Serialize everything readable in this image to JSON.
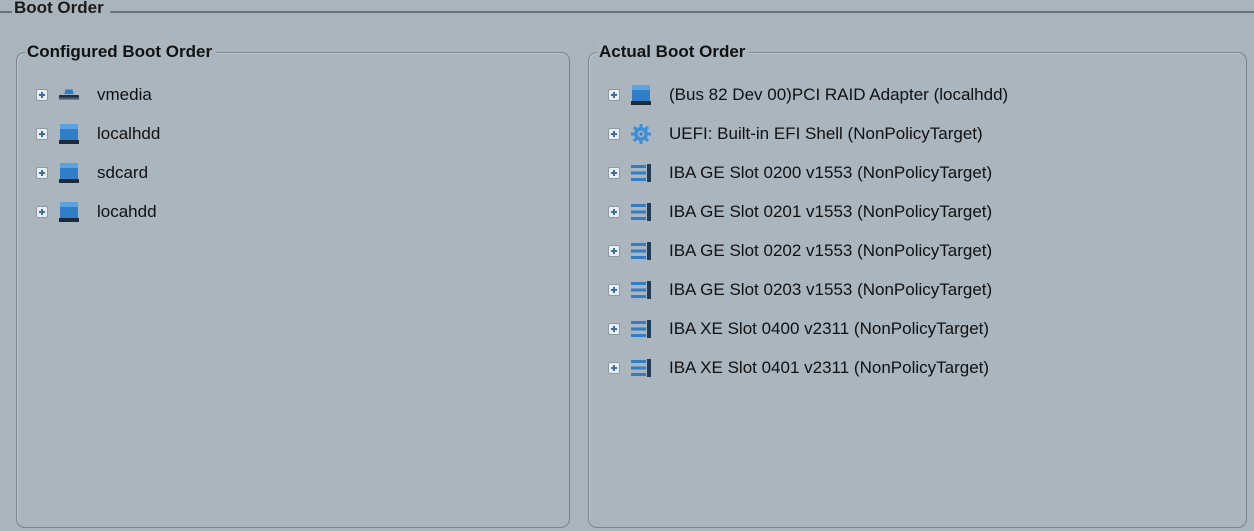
{
  "boot_order": {
    "title": "Boot Order",
    "configured": {
      "title": "Configured Boot Order",
      "items": [
        {
          "label": "vmedia",
          "icon": "vmedia-icon"
        },
        {
          "label": "localhdd",
          "icon": "hdd-icon"
        },
        {
          "label": "sdcard",
          "icon": "hdd-icon"
        },
        {
          "label": "locahdd",
          "icon": "hdd-icon"
        }
      ]
    },
    "actual": {
      "title": "Actual Boot Order",
      "items": [
        {
          "label": "(Bus 82 Dev 00)PCI RAID Adapter (localhdd)",
          "icon": "hdd-icon"
        },
        {
          "label": "UEFI: Built-in EFI Shell  (NonPolicyTarget)",
          "icon": "gear-icon"
        },
        {
          "label": "IBA GE Slot 0200 v1553 (NonPolicyTarget)",
          "icon": "network-icon"
        },
        {
          "label": "IBA GE Slot 0201 v1553 (NonPolicyTarget)",
          "icon": "network-icon"
        },
        {
          "label": "IBA GE Slot 0202 v1553 (NonPolicyTarget)",
          "icon": "network-icon"
        },
        {
          "label": "IBA GE Slot 0203 v1553 (NonPolicyTarget)",
          "icon": "network-icon"
        },
        {
          "label": "IBA XE Slot 0400 v2311 (NonPolicyTarget)",
          "icon": "network-icon"
        },
        {
          "label": "IBA XE Slot 0401 v2311 (NonPolicyTarget)",
          "icon": "network-icon"
        }
      ]
    }
  },
  "colors": {
    "background": "#aab4bd",
    "icon_blue": "#2f7ec7",
    "expander_plus": "#3b6ea8"
  }
}
